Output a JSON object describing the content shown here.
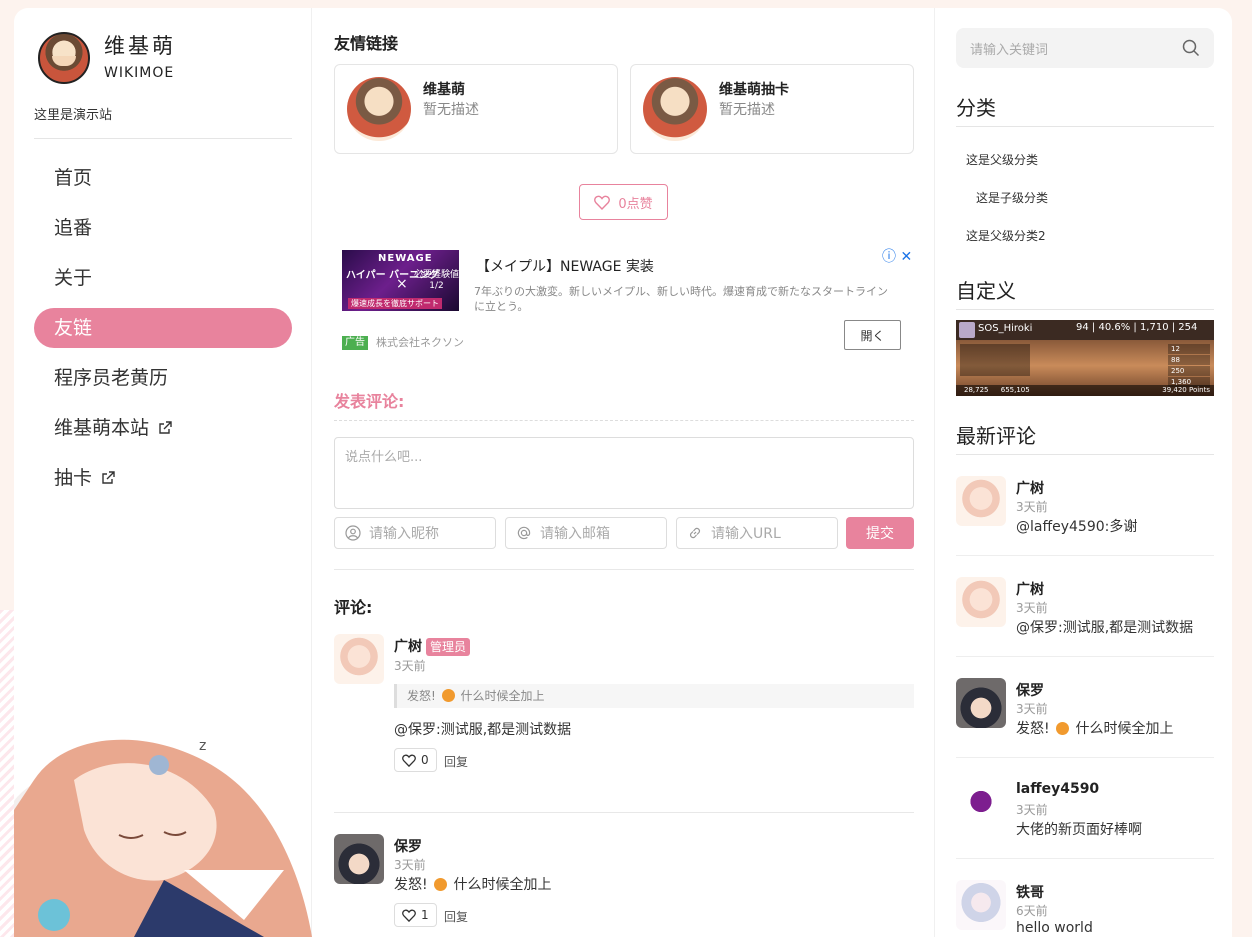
{
  "brand": {
    "name": "维基萌",
    "sub": "WIKIMOE",
    "desc": "这里是演示站"
  },
  "nav": [
    {
      "label": "首页",
      "external": false
    },
    {
      "label": "追番",
      "external": false
    },
    {
      "label": "关于",
      "external": false
    },
    {
      "label": "友链",
      "external": false,
      "active": true
    },
    {
      "label": "程序员老黄历",
      "external": false
    },
    {
      "label": "维基萌本站",
      "external": true
    },
    {
      "label": "抽卡",
      "external": true
    }
  ],
  "friends": {
    "title": "友情链接",
    "cards": [
      {
        "name": "维基萌",
        "desc": "暂无描述"
      },
      {
        "name": "维基萌抽卡",
        "desc": "暂无描述"
      }
    ]
  },
  "like": {
    "label": "0点赞"
  },
  "ad": {
    "title": "【メイプル】NEWAGE 実装",
    "body": "7年ぶりの大激変。新しいメイプル、新しい時代。爆速育成で新たなスタートラインに立とう。",
    "tag": "广告",
    "advertiser": "株式会社ネクソン",
    "open": "開く",
    "image_title": "NEWAGE",
    "image_left": "ハイパー バーニング",
    "image_right": "必要経験値 1/2",
    "image_bottom": "爆速成長を徹底サポート"
  },
  "form": {
    "title": "发表评论:",
    "textarea_placeholder": "说点什么吧...",
    "nickname_placeholder": "请输入昵称",
    "email_placeholder": "请输入邮箱",
    "url_placeholder": "请输入URL",
    "submit": "提交"
  },
  "comments": {
    "title": "评论:",
    "items": [
      {
        "name": "广树",
        "badge": "管理员",
        "time": "3天前",
        "quote_pre": "发怒!",
        "quote_post": "什么时候全加上",
        "text": "@保罗:测试服,都是测试数据",
        "likes": "0",
        "reply": "回复"
      },
      {
        "name": "保罗",
        "time": "3天前",
        "text_pre": "发怒!",
        "text_post": "什么时候全加上",
        "likes": "1",
        "reply": "回复"
      }
    ]
  },
  "search": {
    "placeholder": "请输入关键词"
  },
  "categories": {
    "title": "分类",
    "items": [
      "这是父级分类",
      "这是子级分类",
      "这是父级分类2"
    ]
  },
  "custom": {
    "title": "自定义",
    "psn_name": "SOS_Hiroki",
    "psn_stats": "94 | 40.6% | 1,710 | 254",
    "psn_f1": "28,725",
    "psn_f2": "655,105",
    "psn_points": "39,420 Points",
    "psn_nums": [
      "12",
      "88",
      "250",
      "1,360"
    ]
  },
  "latest": {
    "title": "最新评论",
    "items": [
      {
        "name": "广树",
        "time": "3天前",
        "text": "@laffey4590:多谢"
      },
      {
        "name": "广树",
        "time": "3天前",
        "text": "@保罗:测试服,都是测试数据"
      },
      {
        "name": "保罗",
        "time": "3天前",
        "text_pre": "发怒!",
        "text_post": "什么时候全加上"
      },
      {
        "name": "laffey4590",
        "time": "3天前",
        "text": "大佬的新页面好棒啊"
      },
      {
        "name": "铁哥",
        "time": "6天前",
        "text": "hello world"
      }
    ]
  },
  "colors": {
    "accent": "#e8839d",
    "ad_tag": "#4caf50",
    "emoji": "#f19a2e"
  }
}
